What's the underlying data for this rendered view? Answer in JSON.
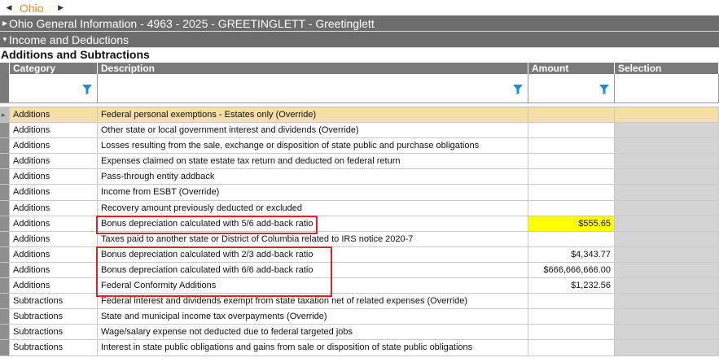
{
  "tabs": {
    "active_label": "Ohio"
  },
  "header": {
    "title": "Ohio General Information - 4963 - 2025 - GREETINGLETT - Greetinglett",
    "section": "Income and Deductions",
    "subsection": "Additions and Subtractions"
  },
  "table": {
    "columns": {
      "category": "Category",
      "description": "Description",
      "amount": "Amount",
      "selection": "Selection"
    },
    "rows": [
      {
        "category": "Additions",
        "description": "Federal personal exemptions - Estates only (Override)",
        "amount": ""
      },
      {
        "category": "Additions",
        "description": "Other state or local government interest and dividends (Override)",
        "amount": ""
      },
      {
        "category": "Additions",
        "description": "Losses resulting from the sale, exchange or disposition of state public and purchase obligations",
        "amount": ""
      },
      {
        "category": "Additions",
        "description": "Expenses claimed on state estate tax return and deducted on federal return",
        "amount": ""
      },
      {
        "category": "Additions",
        "description": "Pass-through entity addback",
        "amount": ""
      },
      {
        "category": "Additions",
        "description": "Income from ESBT (Override)",
        "amount": ""
      },
      {
        "category": "Additions",
        "description": "Recovery amount previously deducted or excluded",
        "amount": ""
      },
      {
        "category": "Additions",
        "description": "Bonus depreciation calculated with 5/6 add-back ratio",
        "amount": "$555.65"
      },
      {
        "category": "Additions",
        "description": "Taxes paid to another state or District of Columbia related to IRS notice 2020-7",
        "amount": ""
      },
      {
        "category": "Additions",
        "description": "Bonus depreciation calculated with 2/3 add-back ratio",
        "amount": "$4,343.77"
      },
      {
        "category": "Additions",
        "description": "Bonus depreciation calculated with 6/6 add-back ratio",
        "amount": "$666,666,666.00"
      },
      {
        "category": "Additions",
        "description": "Federal Conformity Additions",
        "amount": "$1,232.56"
      },
      {
        "category": "Subtractions",
        "description": "Federal interest and dividends exempt from state taxation net of related expenses (Override)",
        "amount": ""
      },
      {
        "category": "Subtractions",
        "description": "State and municipal income tax overpayments (Override)",
        "amount": ""
      },
      {
        "category": "Subtractions",
        "description": "Wage/salary expense not deducted due to federal targeted jobs",
        "amount": ""
      },
      {
        "category": "Subtractions",
        "description": "Interest in state public obligations and gains from sale or disposition of state public obligations",
        "amount": ""
      }
    ]
  },
  "colors": {
    "tab_text": "#f28a1a",
    "selected_row": "#f6dfa5",
    "highlight": "#ffff00",
    "annotation": "#e0202a",
    "filter_icon": "#1a8fd6"
  },
  "icons": {
    "filter": "funnel-filter-icon"
  }
}
